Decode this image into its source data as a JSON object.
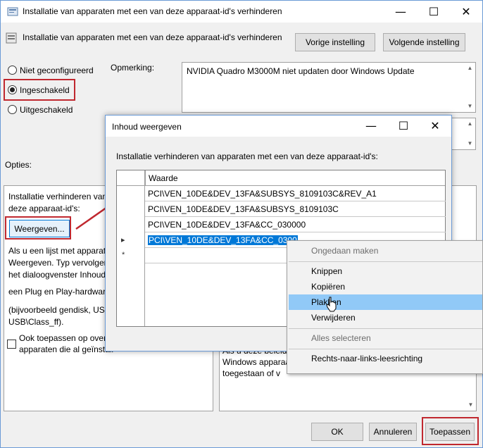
{
  "window": {
    "title": "Installatie van apparaten met een van deze apparaat-id's verhinderen",
    "minimize_glyph": "—",
    "maximize_glyph": "☐",
    "close_glyph": "✕"
  },
  "header": {
    "policy_name": "Installatie van apparaten met een van deze apparaat-id's verhinderen",
    "prev_button": "Vorige instelling",
    "next_button": "Volgende instelling"
  },
  "state": {
    "not_configured": "Niet geconfigureerd",
    "enabled": "Ingeschakeld",
    "disabled": "Uitgeschakeld",
    "selected": "enabled"
  },
  "comment": {
    "label": "Opmerking:",
    "value": "NVIDIA Quadro M3000M niet updaten door Windows Update"
  },
  "options": {
    "label": "Opties:",
    "desc1": "Installatie verhinderen van",
    "desc2": "deze apparaat-id's:",
    "show_button": "Weergeven...",
    "help1": "Als u een lijst met apparate",
    "help2": "Weergeven. Typ vervolgens",
    "help3": "het dialoogvenster Inhoud",
    "help4": "een Plug en Play-hardware",
    "help5": "(bijvoorbeeld gendisk, USB",
    "help6": "USB\\Class_ff).",
    "checkbox1": "Ook toepassen op overe",
    "checkbox2": "apparaten die al geïnstall"
  },
  "help_panel": {
    "line1": "Als u deze beleidsi",
    "line2": "Windows apparaat",
    "line3": "toegestaan of v"
  },
  "footer": {
    "ok": "OK",
    "cancel": "Annuleren",
    "apply": "Toepassen"
  },
  "dialog": {
    "title": "Inhoud weergeven",
    "minimize_glyph": "—",
    "maximize_glyph": "☐",
    "close_glyph": "✕",
    "instruction": "Installatie verhinderen van apparaten met een van deze apparaat-id's:",
    "column_header": "Waarde",
    "rows": [
      "PCI\\VEN_10DE&DEV_13FA&SUBSYS_8109103C&REV_A1",
      "PCI\\VEN_10DE&DEV_13FA&SUBSYS_8109103C",
      "PCI\\VEN_10DE&DEV_13FA&CC_030000",
      "PCI\\VEN_10DE&DEV_13FA&CC_0300"
    ],
    "current_row_marker": "▸",
    "new_row_marker": "*"
  },
  "context_menu": {
    "undo": "Ongedaan maken",
    "cut": "Knippen",
    "copy": "Kopiëren",
    "paste": "Plakken",
    "delete": "Verwijderen",
    "select_all": "Alles selecteren",
    "rtl": "Rechts-naar-links-leesrichting"
  },
  "colors": {
    "highlight": "#0078d7",
    "annotation_red": "#c0282f",
    "menu_hover": "#91c9f7"
  }
}
